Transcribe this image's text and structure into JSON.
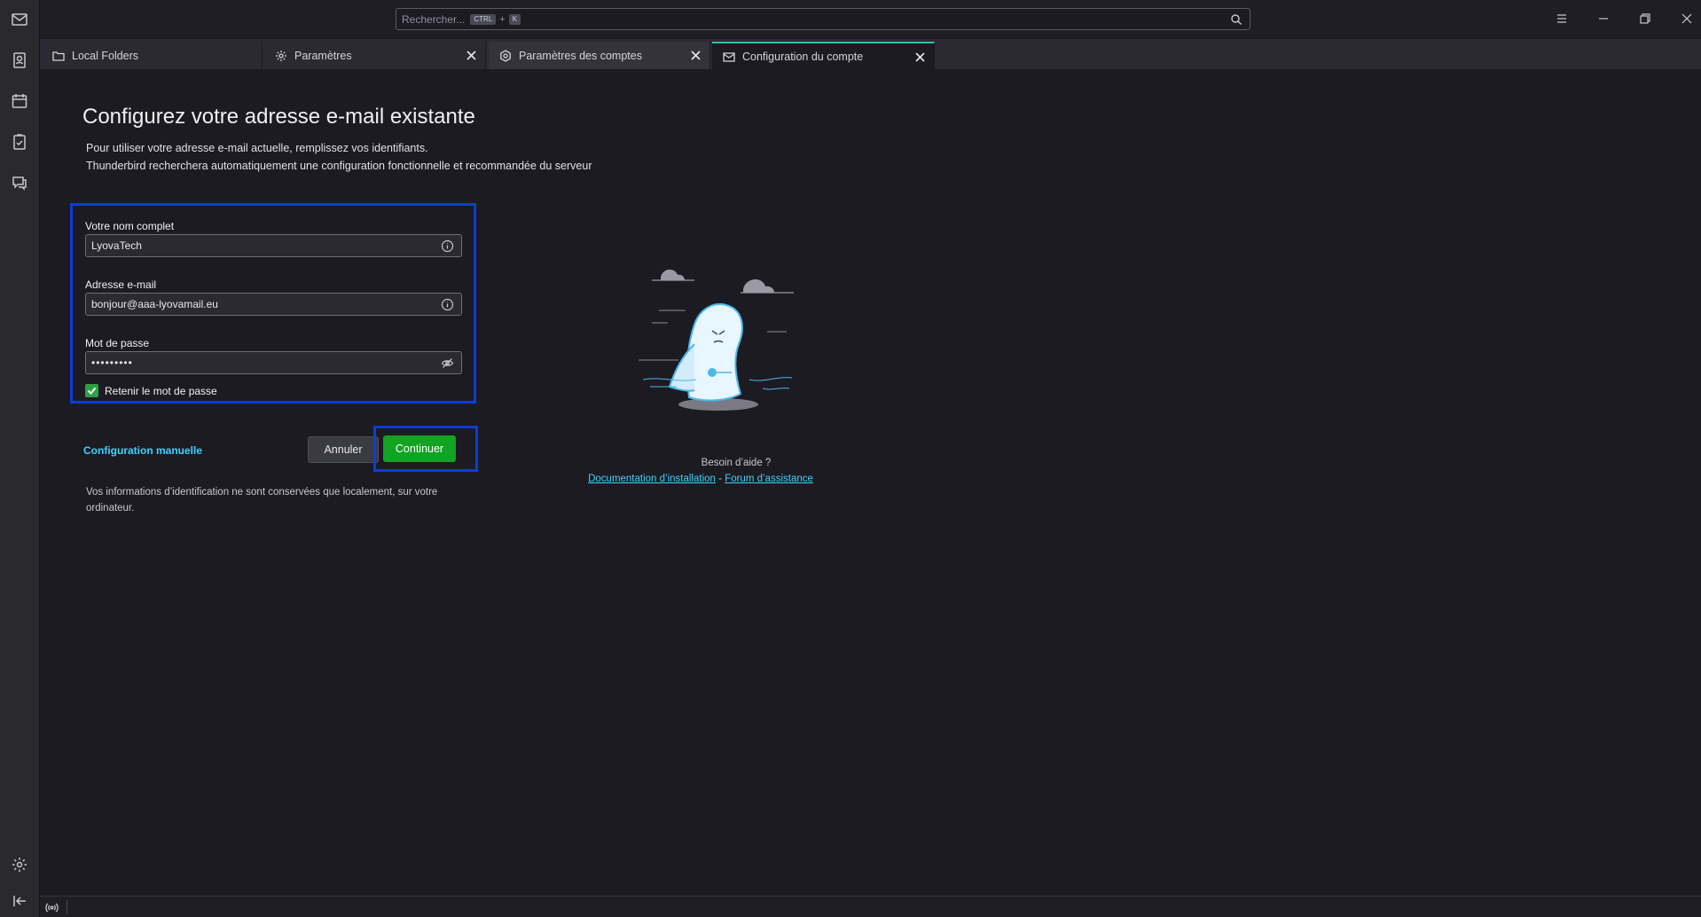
{
  "search": {
    "placeholder": "Rechercher...",
    "shortcut_mod": "CTRL",
    "shortcut_plus": "+",
    "shortcut_key": "K"
  },
  "tabs": [
    {
      "label": "Local Folders",
      "icon": "folder-icon",
      "closable": false
    },
    {
      "label": "Paramètres",
      "icon": "gear-icon",
      "closable": true
    },
    {
      "label": "Paramètres des comptes",
      "icon": "account-settings-icon",
      "closable": true
    },
    {
      "label": "Configuration du compte",
      "icon": "mail-setup-icon",
      "closable": true,
      "selected": true
    }
  ],
  "page": {
    "title": "Configurez votre adresse e-mail existante",
    "desc_line1": "Pour utiliser votre adresse e-mail actuelle, remplissez vos identifiants.",
    "desc_line2": "Thunderbird recherchera automatiquement une configuration fonctionnelle et recommandée du serveur"
  },
  "form": {
    "name_label": "Votre nom complet",
    "name_value": "LyovaTech",
    "email_label": "Adresse e-mail",
    "email_value": "bonjour@aaa-lyovamail.eu",
    "password_label": "Mot de passe",
    "password_value": "•••••••••",
    "remember_label": "Retenir le mot de passe",
    "remember_checked": true
  },
  "actions": {
    "manual_config": "Configuration manuelle",
    "cancel": "Annuler",
    "continue": "Continuer"
  },
  "privacy_note": "Vos informations d’identification ne sont conservées que localement, sur votre ordinateur.",
  "help": {
    "title": "Besoin d’aide ?",
    "doc_link": "Documentation d’installation",
    "separator": "-",
    "forum_link": "Forum d’assistance"
  },
  "colors": {
    "accent_green": "#12a322",
    "link_blue": "#3fd1ff",
    "highlight_border": "#0a3fd6"
  }
}
